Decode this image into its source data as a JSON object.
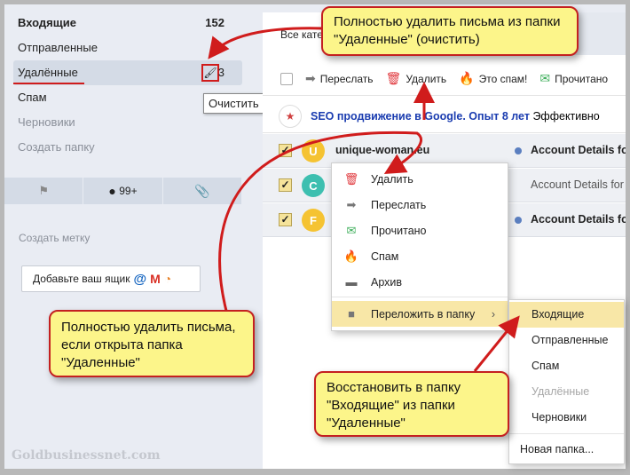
{
  "sidebar": {
    "folders": [
      {
        "label": "Входящие",
        "count": "152"
      },
      {
        "label": "Отправленные",
        "count": ""
      },
      {
        "label": "Удалённые",
        "count": "3"
      },
      {
        "label": "Спам",
        "count": ""
      },
      {
        "label": "Черновики",
        "count": ""
      },
      {
        "label": "Создать папку",
        "count": ""
      }
    ],
    "clean_tooltip": "Очистить",
    "filters": {
      "unread": "99+"
    },
    "create_label": "Создать метку",
    "add_mailbox": "Добавьте ваш ящик"
  },
  "main": {
    "tab": "Все категории",
    "toolbar": {
      "forward": "Переслать",
      "delete": "Удалить",
      "spam": "Это спам!",
      "read": "Прочитано"
    },
    "promo": {
      "subject": "SEO продвижение в Google. Опыт 8 лет",
      "preview": "Эффективно"
    },
    "messages": [
      {
        "avatar": "U",
        "color": "#f5c332",
        "from": "unique-woman.eu",
        "subject": "Account Details for",
        "unread": true
      },
      {
        "avatar": "C",
        "color": "#3dbfb0",
        "from": "",
        "subject": "Account Details for",
        "unread": false
      },
      {
        "avatar": "F",
        "color": "#f5c332",
        "from": "",
        "subject": "Account Details for",
        "unread": true
      }
    ]
  },
  "context_menu": {
    "items": [
      "Удалить",
      "Переслать",
      "Прочитано",
      "Спам",
      "Архив"
    ],
    "move_to": "Переложить в папку",
    "submenu": [
      "Входящие",
      "Отправленные",
      "Спам",
      "Удалённые",
      "Черновики"
    ],
    "new_folder": "Новая папка..."
  },
  "callouts": {
    "top": "Полностью удалить письма из папки \"Удаленные\" (очистить)",
    "left": "Полностью удалить письма, если открыта папка \"Удаленные\"",
    "bottom": "Восстановить в папку \"Входящие\" из папки \"Удаленные\""
  },
  "watermark": "Goldbusinessnet.com"
}
